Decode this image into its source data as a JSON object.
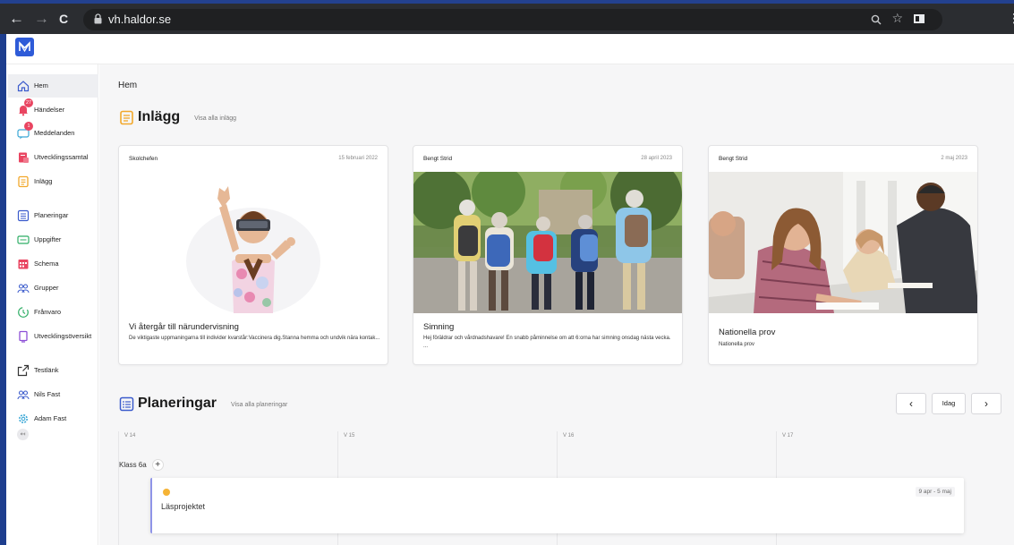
{
  "browser": {
    "url": "vh.haldor.se",
    "back": "←",
    "forward": "→",
    "reload": "C"
  },
  "sidebar": {
    "items": [
      {
        "label": "Hem",
        "icon": "home-icon",
        "active": true
      },
      {
        "label": "Händelser",
        "icon": "bell-icon",
        "badge": "27"
      },
      {
        "label": "Meddelanden",
        "icon": "chat-icon",
        "badge": "1"
      },
      {
        "label": "Utvecklingssamtal",
        "icon": "meeting-icon"
      },
      {
        "label": "Inlägg",
        "icon": "posts-icon"
      },
      {
        "label": "Planeringar",
        "icon": "planning-icon"
      },
      {
        "label": "Uppgifter",
        "icon": "tasks-icon"
      },
      {
        "label": "Schema",
        "icon": "schedule-icon"
      },
      {
        "label": "Grupper",
        "icon": "groups-icon"
      },
      {
        "label": "Frånvaro",
        "icon": "absence-icon"
      },
      {
        "label": "Utvecklingsöversikt",
        "icon": "overview-icon"
      },
      {
        "label": "Testlänk",
        "icon": "external-link-icon"
      },
      {
        "label": "Nils Fast",
        "icon": "users-icon"
      },
      {
        "label": "Adam Fast",
        "icon": "gear-icon"
      }
    ],
    "collapse": "↤"
  },
  "main": {
    "page_title": "Hem",
    "posts": {
      "title": "Inlägg",
      "view_all": "Visa alla inlägg",
      "cards": [
        {
          "author": "Skolchefen",
          "date": "15 februari 2022",
          "title": "Vi återgår till närundervisning",
          "desc": "De viktigaste uppmaningarna till individer kvarstår:Vaccinera dig.Stanna hemma och undvik nära kontak..."
        },
        {
          "author": "Bengt Strid",
          "date": "28 april 2023",
          "title": "Simning",
          "desc": "Hej föräldrar och vårdnadshavare! En snabb påminnelse om att 6:orna har simning onsdag nästa vecka. ..."
        },
        {
          "author": "Bengt Strid",
          "date": "2 maj 2023",
          "title": "Nationella prov",
          "desc": "Nationella prov"
        }
      ]
    },
    "plans": {
      "title": "Planeringar",
      "view_all": "Visa alla planeringar",
      "prev": "‹",
      "today": "Idag",
      "next": "›",
      "weeks": [
        "V 14",
        "V 15",
        "V 16",
        "V 17"
      ],
      "class_label": "Klass 6a",
      "add": "+",
      "plan": {
        "name": "Läsprojektet",
        "range": "9 apr - 5 maj"
      }
    }
  },
  "colors": {
    "accent": "#2e5bd8",
    "badge": "#e94561",
    "plan_dot": "#f5b335",
    "plan_border": "#8f94e8",
    "section_icon": "#f2a82b"
  }
}
